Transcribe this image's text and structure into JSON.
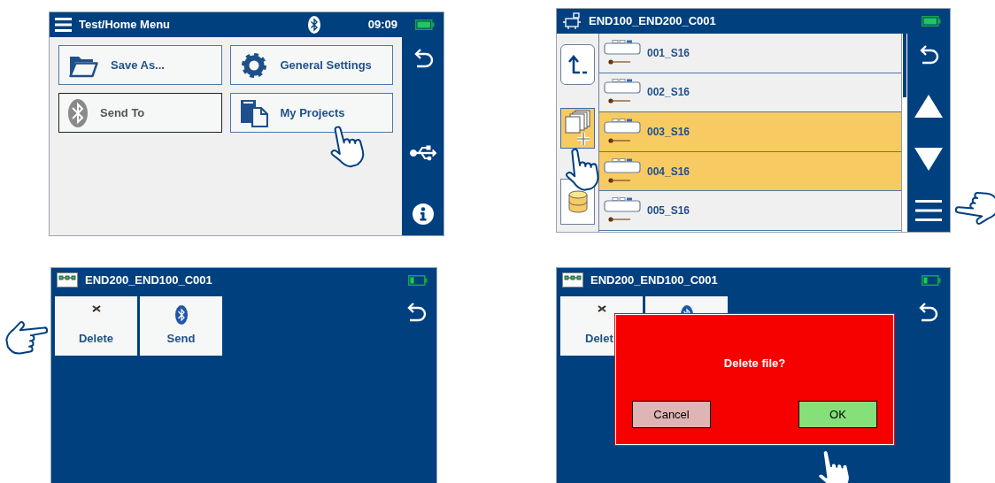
{
  "home_menu": {
    "title": "Test/Home Menu",
    "time": "09:09",
    "buttons": [
      {
        "label": "Save As...",
        "kind": "folder",
        "disabled": false
      },
      {
        "label": "General Settings",
        "kind": "gear",
        "disabled": false
      },
      {
        "label": "Send To",
        "kind": "bluetooth",
        "disabled": true
      },
      {
        "label": "My Projects",
        "kind": "files",
        "disabled": false
      }
    ]
  },
  "project_list": {
    "title": "END100_END200_C001",
    "tools": [
      {
        "kind": "up",
        "selected": false
      },
      {
        "kind": "copy",
        "selected": true
      },
      {
        "kind": "database",
        "selected": false
      }
    ],
    "files": [
      {
        "name": "001_S16",
        "selected": false
      },
      {
        "name": "002_S16",
        "selected": false
      },
      {
        "name": "003_S16",
        "selected": true
      },
      {
        "name": "004_S16",
        "selected": true
      },
      {
        "name": "005_S16",
        "selected": false
      }
    ]
  },
  "file_menu": {
    "title": "END200_END100_C001",
    "tiles": [
      {
        "kind": "delete",
        "label": "Delete"
      },
      {
        "kind": "bluetooth",
        "label": "Send"
      }
    ]
  },
  "delete_confirm": {
    "title": "END200_END100_C001",
    "tiles": [
      {
        "kind": "delete",
        "label": "Delet"
      },
      {
        "kind": "bluetooth"
      }
    ],
    "dialog": {
      "message": "Delete file?",
      "buttons": [
        {
          "kind": "cancel",
          "label": "Cancel"
        },
        {
          "kind": "ok",
          "label": "OK"
        }
      ]
    }
  }
}
